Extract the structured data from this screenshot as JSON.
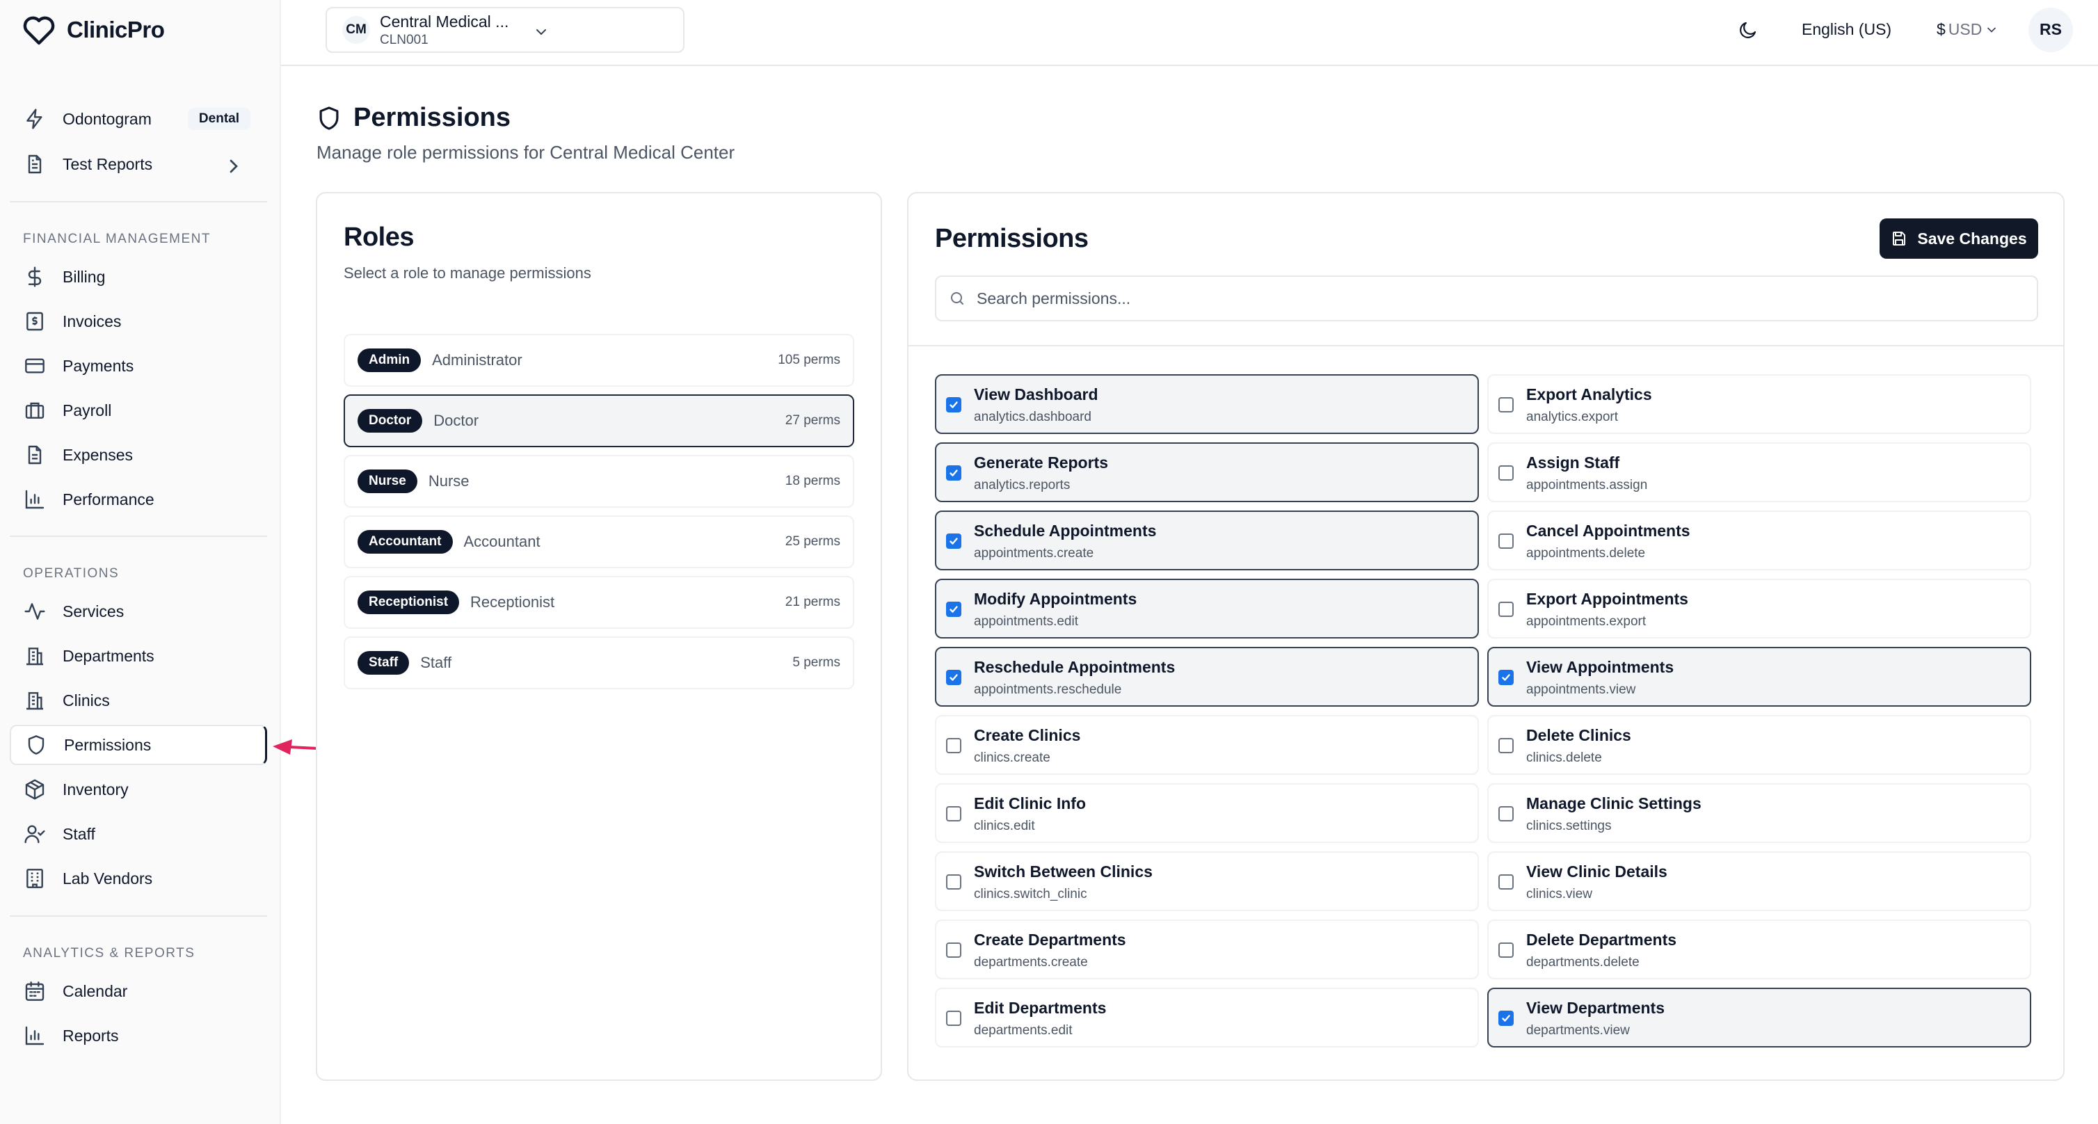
{
  "app": {
    "name": "ClinicPro"
  },
  "sidebar": {
    "top_items": [
      {
        "label": "Odontogram",
        "badge": "Dental",
        "icon": "bolt-icon"
      },
      {
        "label": "Test Reports",
        "icon": "document-icon",
        "has_chevron": true
      }
    ],
    "sections": [
      {
        "title": "FINANCIAL MANAGEMENT",
        "items": [
          {
            "label": "Billing",
            "icon": "dollar-icon"
          },
          {
            "label": "Invoices",
            "icon": "invoice-icon"
          },
          {
            "label": "Payments",
            "icon": "credit-card-icon"
          },
          {
            "label": "Payroll",
            "icon": "briefcase-icon"
          },
          {
            "label": "Expenses",
            "icon": "receipt-icon"
          },
          {
            "label": "Performance",
            "icon": "bar-chart-icon"
          }
        ]
      },
      {
        "title": "OPERATIONS",
        "items": [
          {
            "label": "Services",
            "icon": "activity-icon"
          },
          {
            "label": "Departments",
            "icon": "building-icon"
          },
          {
            "label": "Clinics",
            "icon": "building-icon"
          },
          {
            "label": "Permissions",
            "icon": "shield-icon",
            "active": true
          },
          {
            "label": "Inventory",
            "icon": "package-icon"
          },
          {
            "label": "Staff",
            "icon": "user-check-icon"
          },
          {
            "label": "Lab Vendors",
            "icon": "flask-building-icon"
          }
        ]
      },
      {
        "title": "ANALYTICS & REPORTS",
        "items": [
          {
            "label": "Calendar",
            "icon": "calendar-icon"
          },
          {
            "label": "Reports",
            "icon": "bar-chart-icon"
          }
        ]
      }
    ]
  },
  "topbar": {
    "clinic": {
      "initials": "CM",
      "name": "Central Medical ...",
      "code": "CLN001"
    },
    "language": "English (US)",
    "currency_symbol": "$",
    "currency_code": "USD",
    "user_initials": "RS"
  },
  "page": {
    "title": "Permissions",
    "subtitle": "Manage role permissions for Central Medical Center"
  },
  "roles": {
    "title": "Roles",
    "subtitle": "Select a role to manage permissions",
    "items": [
      {
        "tag": "Admin",
        "name": "Administrator",
        "perms": "105 perms"
      },
      {
        "tag": "Doctor",
        "name": "Doctor",
        "perms": "27 perms",
        "selected": true
      },
      {
        "tag": "Nurse",
        "name": "Nurse",
        "perms": "18 perms"
      },
      {
        "tag": "Accountant",
        "name": "Accountant",
        "perms": "25 perms"
      },
      {
        "tag": "Receptionist",
        "name": "Receptionist",
        "perms": "21 perms"
      },
      {
        "tag": "Staff",
        "name": "Staff",
        "perms": "5 perms"
      }
    ]
  },
  "permissions": {
    "title": "Permissions",
    "save_label": "Save Changes",
    "search_placeholder": "Search permissions...",
    "items": [
      {
        "label": "View Dashboard",
        "key": "analytics.dashboard",
        "checked": true
      },
      {
        "label": "Export Analytics",
        "key": "analytics.export",
        "checked": false
      },
      {
        "label": "Generate Reports",
        "key": "analytics.reports",
        "checked": true
      },
      {
        "label": "Assign Staff",
        "key": "appointments.assign",
        "checked": false
      },
      {
        "label": "Schedule Appointments",
        "key": "appointments.create",
        "checked": true
      },
      {
        "label": "Cancel Appointments",
        "key": "appointments.delete",
        "checked": false
      },
      {
        "label": "Modify Appointments",
        "key": "appointments.edit",
        "checked": true
      },
      {
        "label": "Export Appointments",
        "key": "appointments.export",
        "checked": false
      },
      {
        "label": "Reschedule Appointments",
        "key": "appointments.reschedule",
        "checked": true
      },
      {
        "label": "View Appointments",
        "key": "appointments.view",
        "checked": true
      },
      {
        "label": "Create Clinics",
        "key": "clinics.create",
        "checked": false
      },
      {
        "label": "Delete Clinics",
        "key": "clinics.delete",
        "checked": false
      },
      {
        "label": "Edit Clinic Info",
        "key": "clinics.edit",
        "checked": false
      },
      {
        "label": "Manage Clinic Settings",
        "key": "clinics.settings",
        "checked": false
      },
      {
        "label": "Switch Between Clinics",
        "key": "clinics.switch_clinic",
        "checked": false
      },
      {
        "label": "View Clinic Details",
        "key": "clinics.view",
        "checked": false
      },
      {
        "label": "Create Departments",
        "key": "departments.create",
        "checked": false
      },
      {
        "label": "Delete Departments",
        "key": "departments.delete",
        "checked": false
      },
      {
        "label": "Edit Departments",
        "key": "departments.edit",
        "checked": false
      },
      {
        "label": "View Departments",
        "key": "departments.view",
        "checked": true
      }
    ]
  },
  "colors": {
    "primary": "#0f172a",
    "checkbox": "#1a73e8",
    "annotation_arrow": "#e0245e"
  }
}
